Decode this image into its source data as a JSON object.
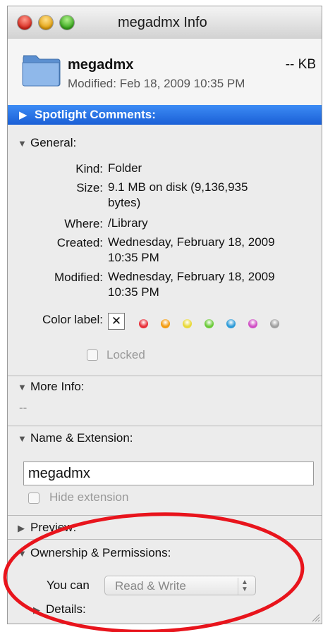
{
  "window": {
    "title": "megadmx Info"
  },
  "file": {
    "name": "megadmx",
    "size": "-- KB",
    "modified": "Modified: Feb 18, 2009 10:35 PM"
  },
  "spotlight": {
    "label": "Spotlight Comments:"
  },
  "general": {
    "label": "General:",
    "kind_label": "Kind:",
    "kind": "Folder",
    "size_label": "Size:",
    "size_line1": "9.1 MB on disk (9,136,935",
    "size_line2": "bytes)",
    "where_label": "Where:",
    "where": "/Library",
    "created_label": "Created:",
    "created_line1": "Wednesday, February 18, 2009",
    "created_line2": "10:35 PM",
    "modified_label": "Modified:",
    "modified_line1": "Wednesday, February 18, 2009",
    "modified_line2": "10:35 PM",
    "color_label": "Color label:",
    "color_none": "✕",
    "color_swatches": [
      "#e8303a",
      "#f39c12",
      "#e9d93a",
      "#6ccb3a",
      "#2e9bd8",
      "#d04fc5",
      "#a0a0a0"
    ],
    "locked_label": "Locked"
  },
  "more_info": {
    "label": "More Info:",
    "value": "--"
  },
  "name_ext": {
    "label": "Name & Extension:",
    "name_value": "megadmx",
    "hide_extension_label": "Hide extension"
  },
  "preview": {
    "label": "Preview:"
  },
  "ownership": {
    "label": "Ownership & Permissions:",
    "you_can_label": "You can",
    "you_can_value": "Read & Write",
    "details_label": "Details:"
  },
  "colors": {
    "selection_blue": "#2a6fe0",
    "annotation_red": "#e8141c"
  }
}
